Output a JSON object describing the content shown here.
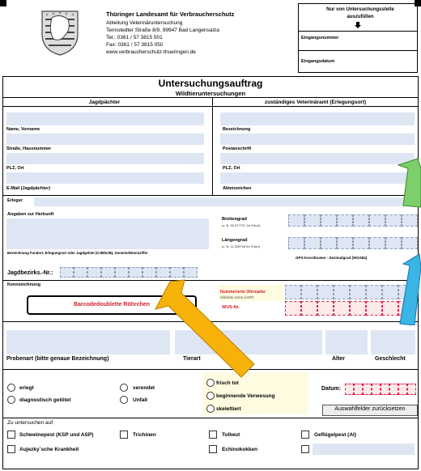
{
  "header": {
    "org_name": "Thüringer Landesamt für Verbraucherschutz",
    "department": "Abteilung Veterinäruntersuchung",
    "address": "Tennstedter Straße 8/9, 99947 Bad Langensalza",
    "phone": "Tel.: 0361 / 57 3815 501",
    "fax": "Fax: 0361 / 57 3815 050",
    "web": "www.verbraucherschutz-thueringen.de"
  },
  "office_box": {
    "title": "Nur von Untersuchungsstelle auszufüllen",
    "arrow": "🡇",
    "entry_number": "Eingangsnummer",
    "entry_date": "Eingangsdatum"
  },
  "title": {
    "main": "Untersuchungsauftrag",
    "sub": "Wildtieruntersuchungen"
  },
  "columns": {
    "left": "Jagdpächter",
    "right": "zuständiges Veterinäramt (Erlegungsort)"
  },
  "left_fields": [
    "Name, Vorname",
    "Straße, Hausnummer",
    "PLZ, Ort",
    "E-Mail (Jagdpächter)"
  ],
  "right_fields": [
    "Bezeichnung",
    "Postanschrift",
    "PLZ, Ort",
    "Aktenzeichen"
  ],
  "erleger": {
    "label": "Erleger",
    "origin": "Angaben zur Herkunft",
    "location_note": "Bezeichnung Fundort, Erlegungsort oder Jagdgebiet (GJB/EJB), Gemeindekennziffer",
    "district_no": "Jagdbezirks.-Nr.:",
    "lat_label": "Breitengrad",
    "lat_example": "(z. B. 50.977797 für Erfurt)",
    "lon_label": "Längengrad",
    "lon_example": "(z. B. 11.028736 für Erfurt)",
    "gps_note": "GPS-Koordinaten - Dezimalgrad (WGS84)"
  },
  "marking": {
    "label": "Kennzeichnung",
    "barcode_button": "Barcodedoublette Röhrchen",
    "ear_tag": "Nummerierte Ohrmarke",
    "infected_zone": "infizierte Zone (ASP)",
    "wus": "WUS-Nr."
  },
  "sample_row": {
    "sample_type": "Probenart (bitte genaue Bezeichnung)",
    "animal": "Tierart",
    "age": "Alter",
    "sex": "Geschlecht"
  },
  "status": {
    "options_col1": [
      "erlegt",
      "diagnostisch getötet"
    ],
    "options_col2": [
      "verendet",
      "Unfall"
    ],
    "options_col3": [
      "frisch tot",
      "beginnende Verwesung",
      "skelettiert"
    ],
    "date_label": "Datum:",
    "reset_button": "Auswahlfelder zurücksetzen"
  },
  "tests": {
    "label": "Zu untersuchen auf:",
    "items": [
      "Schweinepest (KSP und ASP)",
      "Trichinen",
      "Tollwut",
      "Geflügelpest (AI)",
      "Aujezky`sche Krankheit",
      "Echinokokken"
    ]
  },
  "colors": {
    "field": "#dfe6f3",
    "yellow_arrow": "#f7b20a",
    "green_arrow": "#7ccf6a",
    "blue_arrow": "#3bb4e6",
    "red_text": "#d0202a"
  }
}
